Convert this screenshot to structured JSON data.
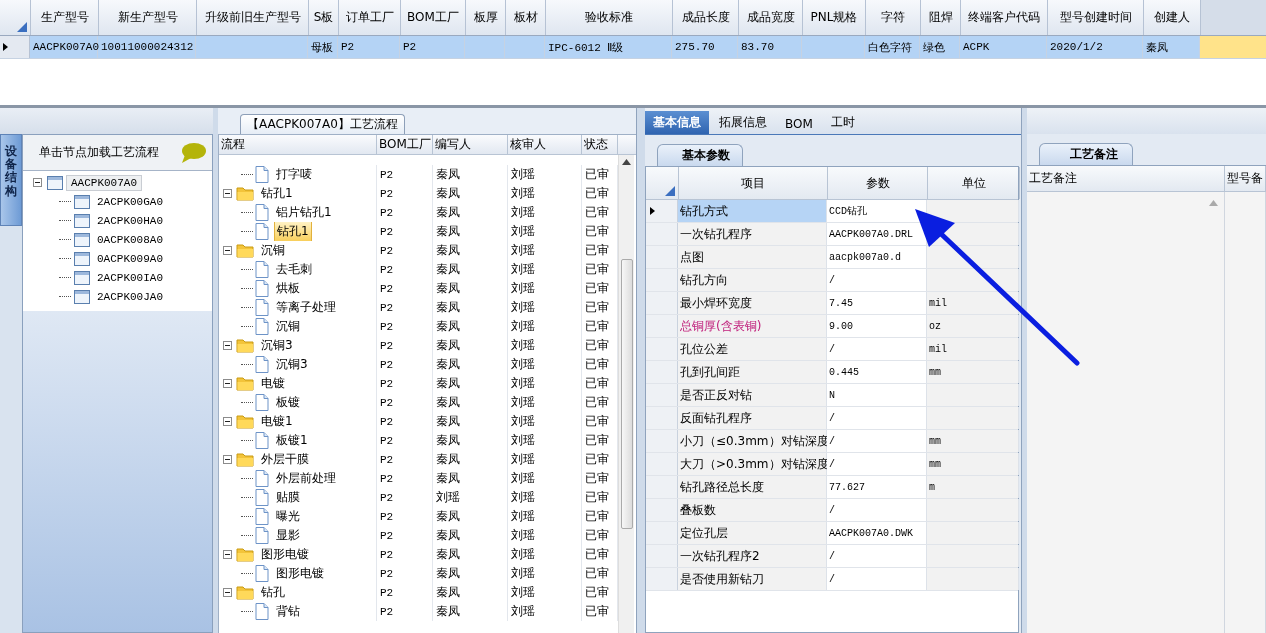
{
  "product_grid": {
    "columns": [
      "生产型号",
      "新生产型号",
      "升级前旧生产型号",
      "S板",
      "订单工厂",
      "BOM工厂",
      "板厚",
      "板材",
      "验收标准",
      "成品长度",
      "成品宽度",
      "PNL规格",
      "字符",
      "阻焊",
      "终端客户代码",
      "型号创建时间",
      "创建人"
    ],
    "rows": [
      {
        "selected": true,
        "cells": [
          "AACPK007A0",
          "10011000024312",
          null,
          "母板",
          "P2",
          "P2",
          null,
          null,
          "IPC-6012 Ⅱ级",
          "275.70",
          "83.70",
          null,
          "白色字符",
          "绿色",
          "ACPK",
          "2020/1/2",
          "秦凤"
        ]
      }
    ]
  },
  "structure_panel": {
    "side_tab": "设备结构",
    "header": "单击节点加载工艺流程",
    "tree": [
      {
        "label": "AACPK007A0",
        "selected": true,
        "expanded": true,
        "children": [
          {
            "label": "2ACPK00GA0",
            "selected": false
          },
          {
            "label": "2ACPK00HA0",
            "selected": false
          },
          {
            "label": "0ACPK008A0",
            "selected": false
          },
          {
            "label": "0ACPK009A0",
            "selected": false
          },
          {
            "label": "2ACPK00IA0",
            "selected": false
          },
          {
            "label": "2ACPK00JA0",
            "selected": false
          }
        ]
      }
    ]
  },
  "process": {
    "title": "【AACPK007A0】工艺流程",
    "columns": [
      "流程",
      "BOM工厂",
      "编写人",
      "核审人",
      "状态"
    ],
    "steps": [
      {
        "kind": "file",
        "name": "打字唛",
        "factory": "P2",
        "writer": "秦凤",
        "reviewer": "刘瑶",
        "status": "已审",
        "selected": false
      },
      {
        "kind": "folder",
        "name": "钻孔1",
        "factory": "P2",
        "writer": "秦凤",
        "reviewer": "刘瑶",
        "status": "已审",
        "selected": false,
        "expanded": true,
        "children": [
          {
            "kind": "file",
            "name": "铝片钻孔1",
            "factory": "P2",
            "writer": "秦凤",
            "reviewer": "刘瑶",
            "status": "已审",
            "selected": false
          },
          {
            "kind": "file",
            "name": "钻孔1",
            "factory": "P2",
            "writer": "秦凤",
            "reviewer": "刘瑶",
            "status": "已审",
            "selected": true
          }
        ]
      },
      {
        "kind": "folder",
        "name": "沉铜",
        "factory": "P2",
        "writer": "秦凤",
        "reviewer": "刘瑶",
        "status": "已审",
        "selected": false,
        "expanded": true,
        "children": [
          {
            "kind": "file",
            "name": "去毛刺",
            "factory": "P2",
            "writer": "秦凤",
            "reviewer": "刘瑶",
            "status": "已审",
            "selected": false
          },
          {
            "kind": "file",
            "name": "烘板",
            "factory": "P2",
            "writer": "秦凤",
            "reviewer": "刘瑶",
            "status": "已审",
            "selected": false
          },
          {
            "kind": "file",
            "name": "等离子处理",
            "factory": "P2",
            "writer": "秦凤",
            "reviewer": "刘瑶",
            "status": "已审",
            "selected": false
          },
          {
            "kind": "file",
            "name": "沉铜",
            "factory": "P2",
            "writer": "秦凤",
            "reviewer": "刘瑶",
            "status": "已审",
            "selected": false
          }
        ]
      },
      {
        "kind": "folder",
        "name": "沉铜3",
        "factory": "P2",
        "writer": "秦凤",
        "reviewer": "刘瑶",
        "status": "已审",
        "selected": false,
        "expanded": true,
        "children": [
          {
            "kind": "file",
            "name": "沉铜3",
            "factory": "P2",
            "writer": "秦凤",
            "reviewer": "刘瑶",
            "status": "已审",
            "selected": false
          }
        ]
      },
      {
        "kind": "folder",
        "name": "电镀",
        "factory": "P2",
        "writer": "秦凤",
        "reviewer": "刘瑶",
        "status": "已审",
        "selected": false,
        "expanded": true,
        "children": [
          {
            "kind": "file",
            "name": "板镀",
            "factory": "P2",
            "writer": "秦凤",
            "reviewer": "刘瑶",
            "status": "已审",
            "selected": false
          }
        ]
      },
      {
        "kind": "folder",
        "name": "电镀1",
        "factory": "P2",
        "writer": "秦凤",
        "reviewer": "刘瑶",
        "status": "已审",
        "selected": false,
        "expanded": true,
        "children": [
          {
            "kind": "file",
            "name": "板镀1",
            "factory": "P2",
            "writer": "秦凤",
            "reviewer": "刘瑶",
            "status": "已审",
            "selected": false
          }
        ]
      },
      {
        "kind": "folder",
        "name": "外层干膜",
        "factory": "P2",
        "writer": "秦凤",
        "reviewer": "刘瑶",
        "status": "已审",
        "selected": false,
        "expanded": true,
        "children": [
          {
            "kind": "file",
            "name": "外层前处理",
            "factory": "P2",
            "writer": "秦凤",
            "reviewer": "刘瑶",
            "status": "已审",
            "selected": false
          },
          {
            "kind": "file",
            "name": "贴膜",
            "factory": "P2",
            "writer": "刘瑶",
            "reviewer": "刘瑶",
            "status": "已审",
            "selected": false
          },
          {
            "kind": "file",
            "name": "曝光",
            "factory": "P2",
            "writer": "秦凤",
            "reviewer": "刘瑶",
            "status": "已审",
            "selected": false
          },
          {
            "kind": "file",
            "name": "显影",
            "factory": "P2",
            "writer": "秦凤",
            "reviewer": "刘瑶",
            "status": "已审",
            "selected": false
          }
        ]
      },
      {
        "kind": "folder",
        "name": "图形电镀",
        "factory": "P2",
        "writer": "秦凤",
        "reviewer": "刘瑶",
        "status": "已审",
        "selected": false,
        "expanded": true,
        "children": [
          {
            "kind": "file",
            "name": "图形电镀",
            "factory": "P2",
            "writer": "秦凤",
            "reviewer": "刘瑶",
            "status": "已审",
            "selected": false
          }
        ]
      },
      {
        "kind": "folder",
        "name": "钻孔",
        "factory": "P2",
        "writer": "秦凤",
        "reviewer": "刘瑶",
        "status": "已审",
        "selected": false,
        "expanded": true,
        "children": [
          {
            "kind": "file",
            "name": "背钻",
            "factory": "P2",
            "writer": "秦凤",
            "reviewer": "刘瑶",
            "status": "已审",
            "selected": false
          }
        ]
      }
    ]
  },
  "detail": {
    "tabs": [
      {
        "label": "基本信息",
        "selected": true
      },
      {
        "label": "拓展信息",
        "selected": false
      },
      {
        "label": "BOM",
        "selected": false
      },
      {
        "label": "工时",
        "selected": false
      }
    ],
    "sub_tab": "基本参数",
    "columns": [
      "项目",
      "参数",
      "单位"
    ],
    "rows": [
      {
        "item": "钻孔方式",
        "value": "CCD钻孔",
        "selected": true,
        "highlighted": false
      },
      {
        "item": "一次钻孔程序",
        "value": "AACPK007A0.DRL",
        "selected": false,
        "highlighted": false
      },
      {
        "item": "点图",
        "value": "aacpk007a0.d",
        "selected": false,
        "highlighted": false
      },
      {
        "item": "钻孔方向",
        "value": "/",
        "selected": false,
        "highlighted": false
      },
      {
        "item": "最小焊环宽度",
        "value": "7.45",
        "unit": "mil",
        "selected": false,
        "highlighted": false
      },
      {
        "item": "总铜厚(含表铜)",
        "value": "9.00",
        "unit": "oz",
        "selected": false,
        "highlighted": true
      },
      {
        "item": "孔位公差",
        "value": "/",
        "unit": "mil",
        "selected": false,
        "highlighted": false
      },
      {
        "item": "孔到孔间距",
        "value": "0.445",
        "unit": "mm",
        "selected": false,
        "highlighted": false
      },
      {
        "item": "是否正反对钻",
        "value": "N",
        "selected": false,
        "highlighted": false
      },
      {
        "item": "反面钻孔程序",
        "value": "/",
        "selected": false,
        "highlighted": false
      },
      {
        "item": "小刀（≤0.3mm）对钻深度",
        "value": "/",
        "unit": "mm",
        "selected": false,
        "highlighted": false
      },
      {
        "item": "大刀（>0.3mm）对钻深度",
        "value": "/",
        "unit": "mm",
        "selected": false,
        "highlighted": false
      },
      {
        "item": "钻孔路径总长度",
        "value": "77.627",
        "unit": "m",
        "selected": false,
        "highlighted": false
      },
      {
        "item": "叠板数",
        "value": "/",
        "selected": false,
        "highlighted": false
      },
      {
        "item": "定位孔层",
        "value": "AACPK007A0.DWK",
        "selected": false,
        "highlighted": false
      },
      {
        "item": "一次钻孔程序2",
        "value": "/",
        "selected": false,
        "highlighted": false
      },
      {
        "item": "是否使用新钻刀",
        "value": "/",
        "selected": false,
        "highlighted": false
      }
    ]
  },
  "notes": {
    "tab": "工艺备注",
    "columns": [
      "工艺备注",
      "型号备"
    ]
  }
}
